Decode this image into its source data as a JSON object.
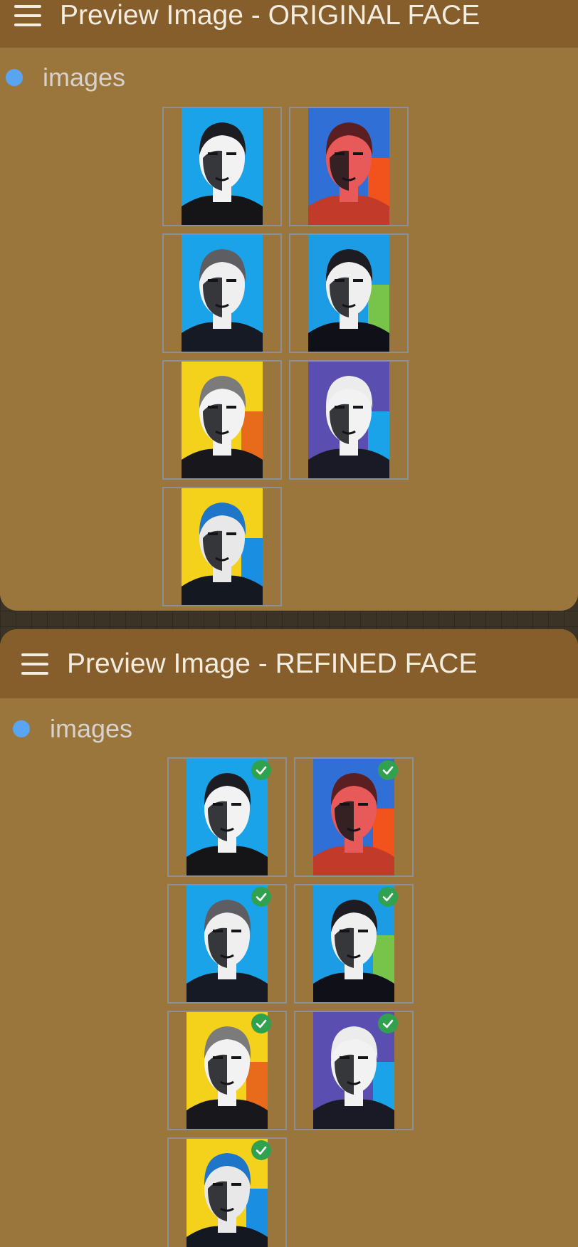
{
  "nodes": [
    {
      "id": "original",
      "title": "Preview Image - ORIGINAL FACE",
      "slot_label": "images",
      "checked": false,
      "images": [
        {
          "bg": "#1aa3e8",
          "bg2": "#1aa3e8",
          "hair": "#1c1c22",
          "skin": "#f2f2f2",
          "shirt": "#151518"
        },
        {
          "bg": "#2f6fd6",
          "bg2": "#f2521c",
          "hair": "#5b1f22",
          "skin": "#e85a5a",
          "shirt": "#c13a2a"
        },
        {
          "bg": "#1aa3e8",
          "bg2": "#1aa3e8",
          "hair": "#5d5d62",
          "skin": "#efefef",
          "shirt": "#161a24"
        },
        {
          "bg": "#1d9ce6",
          "bg2": "#78c34a",
          "hair": "#1c1c22",
          "skin": "#efefef",
          "shirt": "#101018"
        },
        {
          "bg": "#f4d11b",
          "bg2": "#e86a1b",
          "hair": "#7b7b7b",
          "skin": "#f2f2f2",
          "shirt": "#18181c"
        },
        {
          "bg": "#5a4fb0",
          "bg2": "#1aa3e8",
          "hair": "#ececec",
          "skin": "#f2f2f2",
          "shirt": "#1a1a26"
        },
        {
          "bg": "#f4d11b",
          "bg2": "#1a8ee0",
          "hair": "#1f76c9",
          "skin": "#e8e8e8",
          "shirt": "#131821"
        }
      ]
    },
    {
      "id": "refined",
      "title": "Preview Image - REFINED FACE",
      "slot_label": "images",
      "checked": true,
      "images": [
        {
          "bg": "#1aa3e8",
          "bg2": "#1aa3e8",
          "hair": "#1c1c22",
          "skin": "#f2f2f2",
          "shirt": "#151518"
        },
        {
          "bg": "#2f6fd6",
          "bg2": "#f2521c",
          "hair": "#5b1f22",
          "skin": "#e85a5a",
          "shirt": "#c13a2a"
        },
        {
          "bg": "#1aa3e8",
          "bg2": "#1aa3e8",
          "hair": "#5d5d62",
          "skin": "#efefef",
          "shirt": "#161a24"
        },
        {
          "bg": "#1d9ce6",
          "bg2": "#78c34a",
          "hair": "#1c1c22",
          "skin": "#efefef",
          "shirt": "#101018"
        },
        {
          "bg": "#f4d11b",
          "bg2": "#e86a1b",
          "hair": "#7b7b7b",
          "skin": "#f2f2f2",
          "shirt": "#18181c"
        },
        {
          "bg": "#5a4fb0",
          "bg2": "#1aa3e8",
          "hair": "#ececec",
          "skin": "#f2f2f2",
          "shirt": "#1a1a26"
        },
        {
          "bg": "#f4d11b",
          "bg2": "#1a8ee0",
          "hair": "#1f76c9",
          "skin": "#e8e8e8",
          "shirt": "#131821"
        }
      ]
    }
  ]
}
